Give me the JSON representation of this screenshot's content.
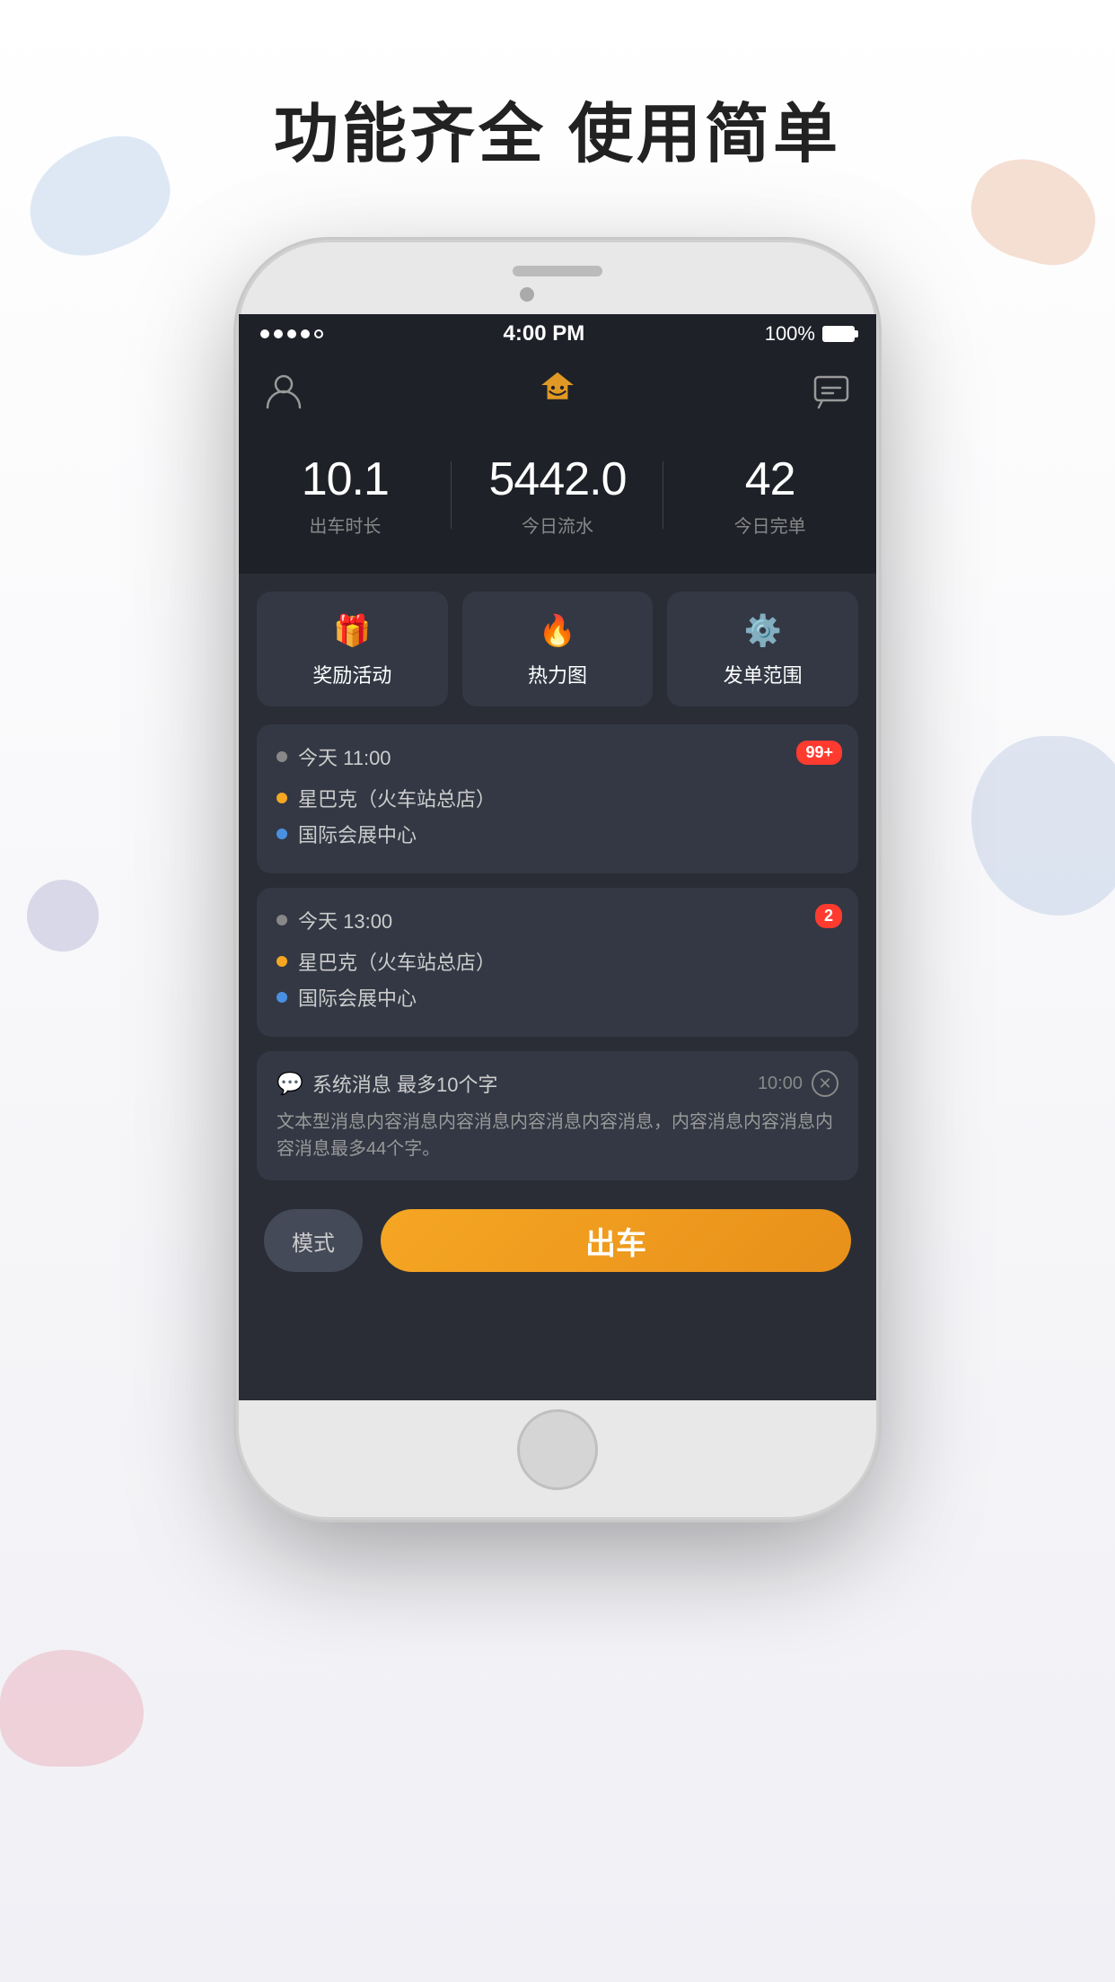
{
  "page": {
    "title": "功能齐全  使用简单",
    "bg_color": "#f5f5f7"
  },
  "status_bar": {
    "dots": [
      "filled",
      "filled",
      "filled",
      "filled",
      "empty"
    ],
    "time": "4:00 PM",
    "battery_percent": "100%"
  },
  "header": {
    "logo_alt": "App Logo"
  },
  "stats": [
    {
      "value": "10.1",
      "label": "出车时长"
    },
    {
      "value": "5442.0",
      "label": "今日流水"
    },
    {
      "value": "42",
      "label": "今日完单"
    }
  ],
  "quick_actions": [
    {
      "icon": "🎁",
      "label": "奖励活动"
    },
    {
      "icon": "🔥",
      "label": "热力图"
    },
    {
      "icon": "⚙️",
      "label": "发单范围"
    }
  ],
  "orders": [
    {
      "time": "今天  11:00",
      "badge": "99+",
      "from": "星巴克（火车站总店）",
      "to": "国际会展中心"
    },
    {
      "time": "今天  13:00",
      "badge": "2",
      "from": "星巴克（火车站总店）",
      "to": "国际会展中心"
    }
  ],
  "notification": {
    "icon": "💬",
    "title": "系统消息  最多10个字",
    "time": "10:00",
    "body": "文本型消息内容消息内容消息内容消息内容消息，内容消息内容消息内容消息最多44个字。"
  },
  "bottom": {
    "mode_label": "模式",
    "go_label": "出车"
  }
}
